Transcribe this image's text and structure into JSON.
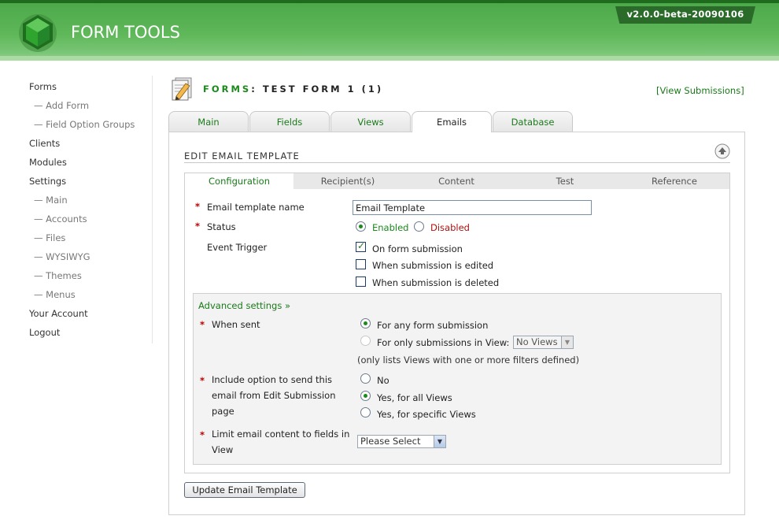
{
  "app": {
    "title": "FORM TOOLS",
    "version": "v2.0.0-beta-20090106"
  },
  "sidebar": {
    "items": [
      {
        "label": "Forms"
      },
      {
        "label": "— Add Form"
      },
      {
        "label": "— Field Option Groups"
      },
      {
        "label": "Clients"
      },
      {
        "label": "Modules"
      },
      {
        "label": "Settings"
      },
      {
        "label": "— Main"
      },
      {
        "label": "— Accounts"
      },
      {
        "label": "— Files"
      },
      {
        "label": "— WYSIWYG"
      },
      {
        "label": "— Themes"
      },
      {
        "label": "— Menus"
      },
      {
        "label": "Your Account"
      },
      {
        "label": "Logout"
      }
    ]
  },
  "page": {
    "heading_prefix": "FORMS",
    "heading_rest": ": TEST FORM 1 (1)",
    "view_submissions": "[View Submissions]"
  },
  "tabs": [
    {
      "label": "Main"
    },
    {
      "label": "Fields"
    },
    {
      "label": "Views"
    },
    {
      "label": "Emails",
      "active": true
    },
    {
      "label": "Database"
    }
  ],
  "section": {
    "title": "EDIT EMAIL TEMPLATE"
  },
  "subtabs": [
    {
      "label": "Configuration",
      "active": true
    },
    {
      "label": "Recipient(s)"
    },
    {
      "label": "Content"
    },
    {
      "label": "Test"
    },
    {
      "label": "Reference"
    }
  ],
  "form": {
    "template_name_label": "Email template name",
    "template_name_value": "Email Template",
    "status_label": "Status",
    "status_enabled": "Enabled",
    "status_disabled": "Disabled",
    "status_selected": "Enabled",
    "event_trigger_label": "Event Trigger",
    "trigger_on_submission": "On form submission",
    "trigger_on_edit": "When submission is edited",
    "trigger_on_delete": "When submission is deleted",
    "required_mark": "*"
  },
  "advanced": {
    "link": "Advanced settings »",
    "when_sent_label": "When sent",
    "when_any": "For any form submission",
    "when_view": "For only submissions in View:",
    "view_select": "No Views",
    "views_note": "(only lists Views with one or more filters defined)",
    "include_label_1": "Include option to send this",
    "include_label_2": "email from Edit Submission",
    "include_label_3": "page",
    "include_no": "No",
    "include_all": "Yes, for all Views",
    "include_specific": "Yes, for specific Views",
    "limit_label_1": "Limit email content to fields in",
    "limit_label_2": "View",
    "limit_select": "Please Select"
  },
  "buttons": {
    "update": "Update Email Template"
  },
  "colors": {
    "header_green": "#5fb85a",
    "accent_green": "#1a8a1a",
    "disabled_red": "#b01010"
  }
}
